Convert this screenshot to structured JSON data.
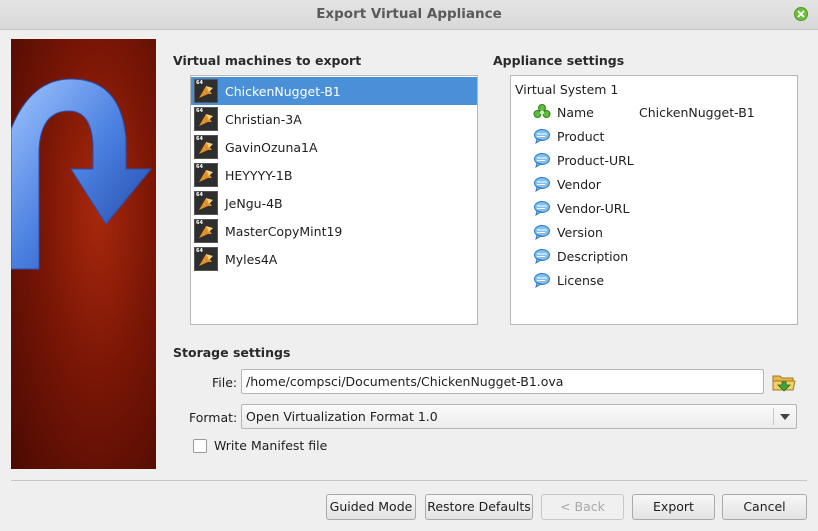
{
  "window": {
    "title": "Export Virtual Appliance"
  },
  "vm_section": {
    "title": "Virtual machines to export",
    "selected_index": 0,
    "items": [
      {
        "name": "ChickenNugget-B1"
      },
      {
        "name": "Christian-3A"
      },
      {
        "name": "GavinOzuna1A"
      },
      {
        "name": "HEYYYY-1B"
      },
      {
        "name": "JeNgu-4B"
      },
      {
        "name": "MasterCopyMint19"
      },
      {
        "name": "Myles4A"
      }
    ],
    "os_badge": "64"
  },
  "appliance_section": {
    "title": "Appliance settings",
    "root_label": "Virtual System 1",
    "rows": [
      {
        "label": "Name",
        "value": "ChickenNugget-B1",
        "icon": "name-icon"
      },
      {
        "label": "Product",
        "value": "",
        "icon": "speech-bubble-icon"
      },
      {
        "label": "Product-URL",
        "value": "",
        "icon": "speech-bubble-icon"
      },
      {
        "label": "Vendor",
        "value": "",
        "icon": "speech-bubble-icon"
      },
      {
        "label": "Vendor-URL",
        "value": "",
        "icon": "speech-bubble-icon"
      },
      {
        "label": "Version",
        "value": "",
        "icon": "speech-bubble-icon"
      },
      {
        "label": "Description",
        "value": "",
        "icon": "speech-bubble-icon"
      },
      {
        "label": "License",
        "value": "",
        "icon": "speech-bubble-icon"
      }
    ]
  },
  "storage_section": {
    "title": "Storage settings",
    "file_label": "File:",
    "file_value": "/home/compsci/Documents/ChickenNugget-B1.ova",
    "format_label": "Format:",
    "format_value": "Open Virtualization Format 1.0",
    "manifest_label": "Write Manifest file",
    "manifest_checked": false
  },
  "buttons": {
    "guided_mode": "Guided Mode",
    "restore_defaults": "Restore Defaults",
    "back": "< Back",
    "export": "Export",
    "cancel": "Cancel"
  },
  "colors": {
    "selection": "#4a90d9",
    "close_button": "#6bbf3a",
    "side_banner": "#7a1606"
  }
}
